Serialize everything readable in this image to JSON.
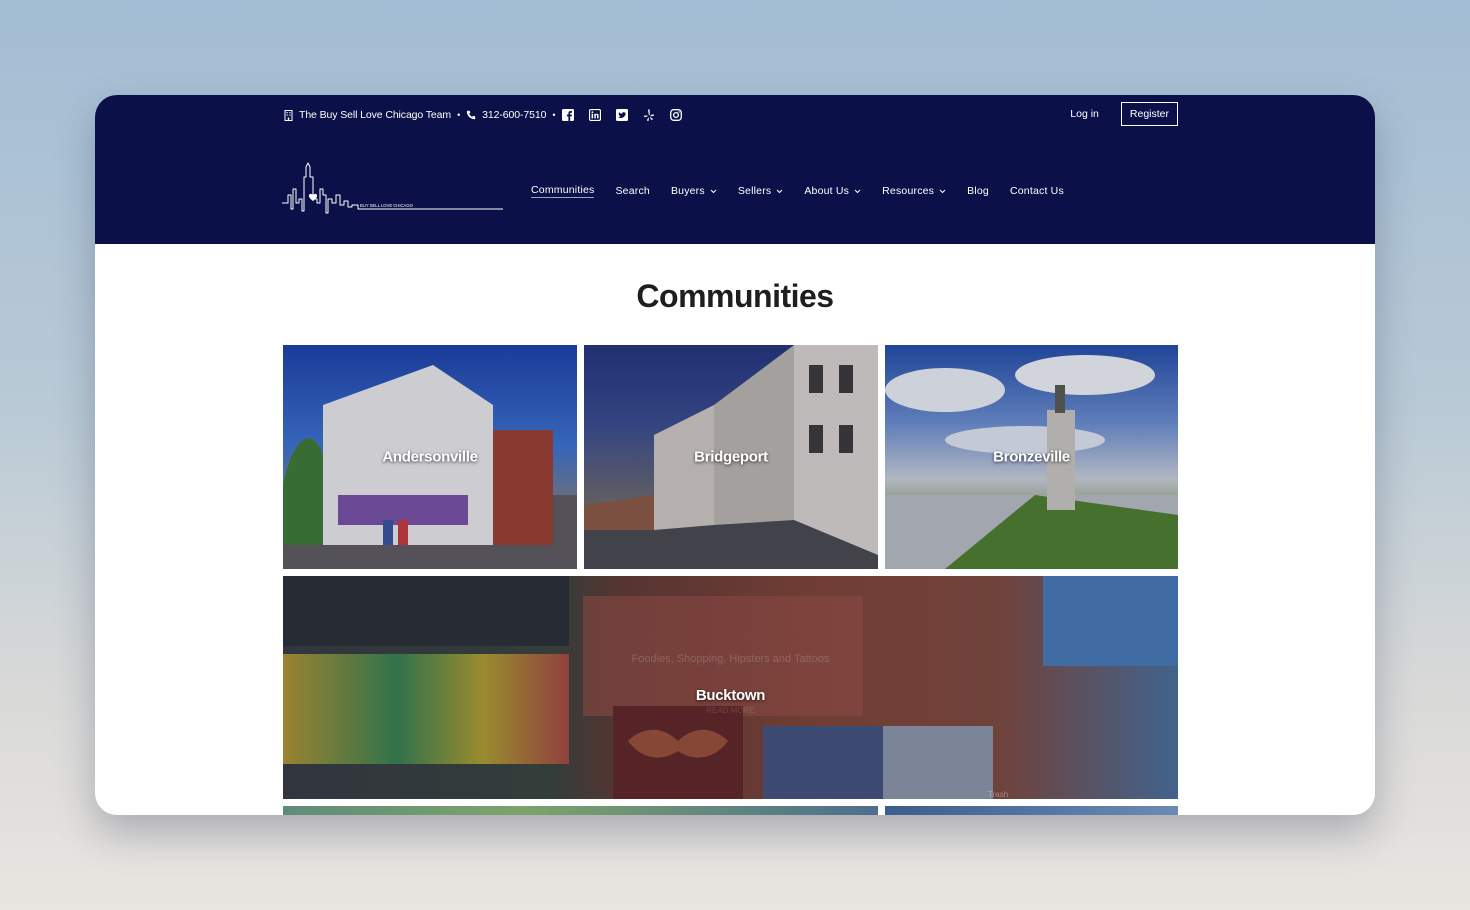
{
  "topbar": {
    "team_name": "The Buy Sell Love Chicago Team",
    "phone": "312-600-7510",
    "separator": "•",
    "building_icon": "building-icon",
    "phone_icon": "phone-icon",
    "social_icons": [
      "facebook-icon",
      "linkedin-icon",
      "twitter-icon",
      "yelp-icon",
      "instagram-icon"
    ]
  },
  "auth": {
    "login": "Log in",
    "register": "Register"
  },
  "logo": {
    "tagline": "BUY SELL LOVE CHICAGO"
  },
  "nav": {
    "items": [
      {
        "label": "Communities",
        "dropdown": false
      },
      {
        "label": "Search",
        "dropdown": false
      },
      {
        "label": "Buyers",
        "dropdown": true
      },
      {
        "label": "Sellers",
        "dropdown": true
      },
      {
        "label": "About Us",
        "dropdown": true
      },
      {
        "label": "Resources",
        "dropdown": true
      },
      {
        "label": "Blog",
        "dropdown": false
      },
      {
        "label": "Contact Us",
        "dropdown": false
      }
    ]
  },
  "main": {
    "title": "Communities",
    "communities": [
      {
        "name": "Andersonville"
      },
      {
        "name": "Bridgeport"
      },
      {
        "name": "Bronzeville"
      },
      {
        "name": "Bucktown",
        "subtitle": "Foodies, Shopping, Hipsters and Tattoos",
        "more": "READ MORE"
      }
    ],
    "trash_label": "Trash"
  },
  "colors": {
    "header": "#0b1148",
    "title": "#1e1e1e",
    "nav_text": "#ffffff"
  }
}
